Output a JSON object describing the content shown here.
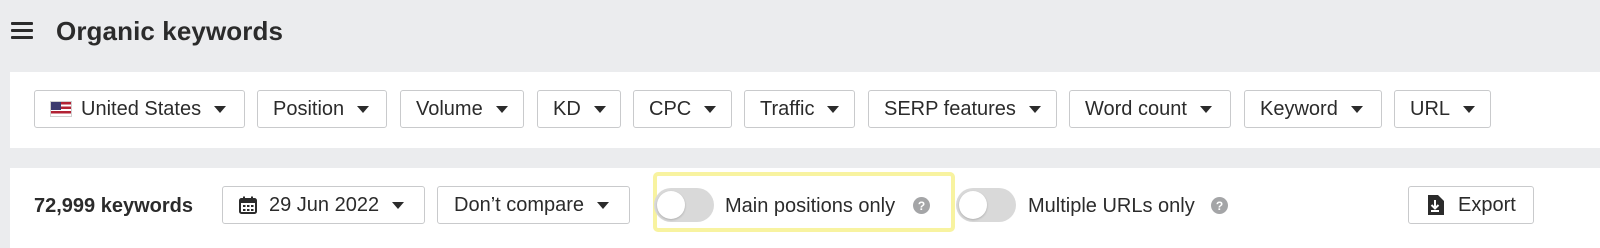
{
  "header": {
    "title": "Organic keywords"
  },
  "filters": [
    {
      "label": "United States",
      "name": "filter-country"
    },
    {
      "label": "Position",
      "name": "filter-position"
    },
    {
      "label": "Volume",
      "name": "filter-volume"
    },
    {
      "label": "KD",
      "name": "filter-kd"
    },
    {
      "label": "CPC",
      "name": "filter-cpc"
    },
    {
      "label": "Traffic",
      "name": "filter-traffic"
    },
    {
      "label": "SERP features",
      "name": "filter-serp-features"
    },
    {
      "label": "Word count",
      "name": "filter-word-count"
    },
    {
      "label": "Keyword",
      "name": "filter-keyword"
    },
    {
      "label": "URL",
      "name": "filter-url"
    }
  ],
  "results": {
    "count_label": "72,999 keywords",
    "date_label": "29 Jun 2022",
    "compare_label": "Don’t compare",
    "main_positions_label": "Main positions only",
    "main_positions_on": false,
    "multiple_urls_label": "Multiple URLs only",
    "multiple_urls_on": false,
    "help_glyph": "?",
    "export_label": "Export",
    "highlight_color": "#f8f3a0"
  }
}
